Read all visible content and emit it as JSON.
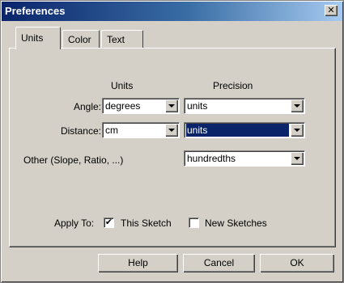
{
  "window": {
    "title": "Preferences",
    "close_glyph": "✕"
  },
  "tabs": [
    {
      "label": "Units",
      "active": true
    },
    {
      "label": "Color",
      "active": false
    },
    {
      "label": "Text",
      "active": false
    }
  ],
  "units_panel": {
    "headers": {
      "units": "Units",
      "precision": "Precision"
    },
    "rows": {
      "angle": {
        "label": "Angle:",
        "units": "degrees",
        "precision": "units"
      },
      "distance": {
        "label": "Distance:",
        "units": "cm",
        "precision": "units"
      },
      "other": {
        "label": "Other (Slope, Ratio, ...)",
        "precision": "hundredths"
      }
    },
    "apply_to": {
      "label": "Apply To:",
      "this_sketch": {
        "label": "This Sketch",
        "checked": true,
        "mark": "✔"
      },
      "new_sketches": {
        "label": "New Sketches",
        "checked": false,
        "mark": ""
      }
    }
  },
  "buttons": {
    "help": "Help",
    "cancel": "Cancel",
    "ok": "OK"
  },
  "colors": {
    "face": "#d4d0c8",
    "title_start": "#0a246a",
    "title_end": "#a6caf0",
    "selection": "#0a246a"
  }
}
